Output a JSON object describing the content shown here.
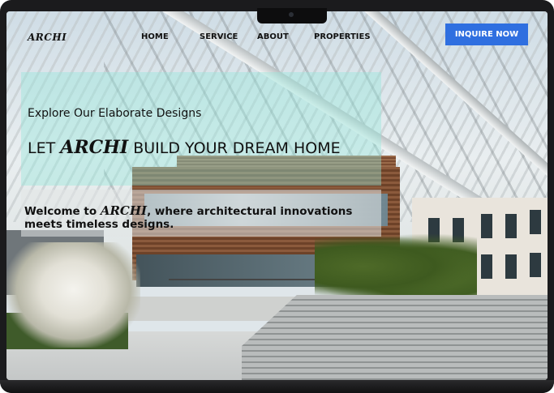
{
  "brand": {
    "logo": "ARCHI"
  },
  "nav": {
    "items": [
      {
        "label": "HOME"
      },
      {
        "label": "SERVICE"
      },
      {
        "label": "ABOUT"
      },
      {
        "label": "PROPERTIES"
      }
    ],
    "cta_label": "INQUIRE NOW",
    "cta_color": "#2f6fe0"
  },
  "hero": {
    "subtitle": "Explore Our Elaborate Designs",
    "title_prefix": "LET ",
    "title_brand": "ARCHI",
    "title_suffix": " BUILD YOUR DREAM HOME",
    "panel_color": "#96e6dc"
  },
  "welcome": {
    "prefix": "Welcome  to ",
    "brand": "ARCHI",
    "suffix": ", where architectural innovations meets timeless designs."
  },
  "background": {
    "image_icon": "modern-building-photo"
  }
}
